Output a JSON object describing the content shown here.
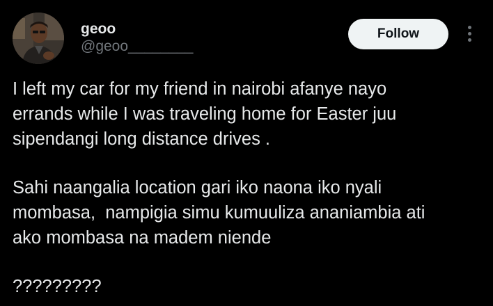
{
  "author": {
    "display_name": "geoo",
    "handle": "@geoo________"
  },
  "header": {
    "follow_label": "Follow",
    "more_icon": "more-vertical-icon"
  },
  "tweet": {
    "paragraphs": [
      [
        "I left my car for my friend in nairobi afanye nayo",
        "errands while I was traveling home for Easter juu",
        "sipendangi long distance drives ."
      ],
      [
        "Sahi naangalia location gari iko naona iko nyali",
        "mombasa,  nampigia simu kumuuliza ananiambia ati",
        "ako mombasa na madem niende"
      ],
      [
        "?????????"
      ]
    ]
  },
  "colors": {
    "background": "#000000",
    "text_primary": "#e7e9ea",
    "text_secondary": "#71767b",
    "follow_bg": "#eff3f4",
    "follow_text": "#0f1419"
  }
}
